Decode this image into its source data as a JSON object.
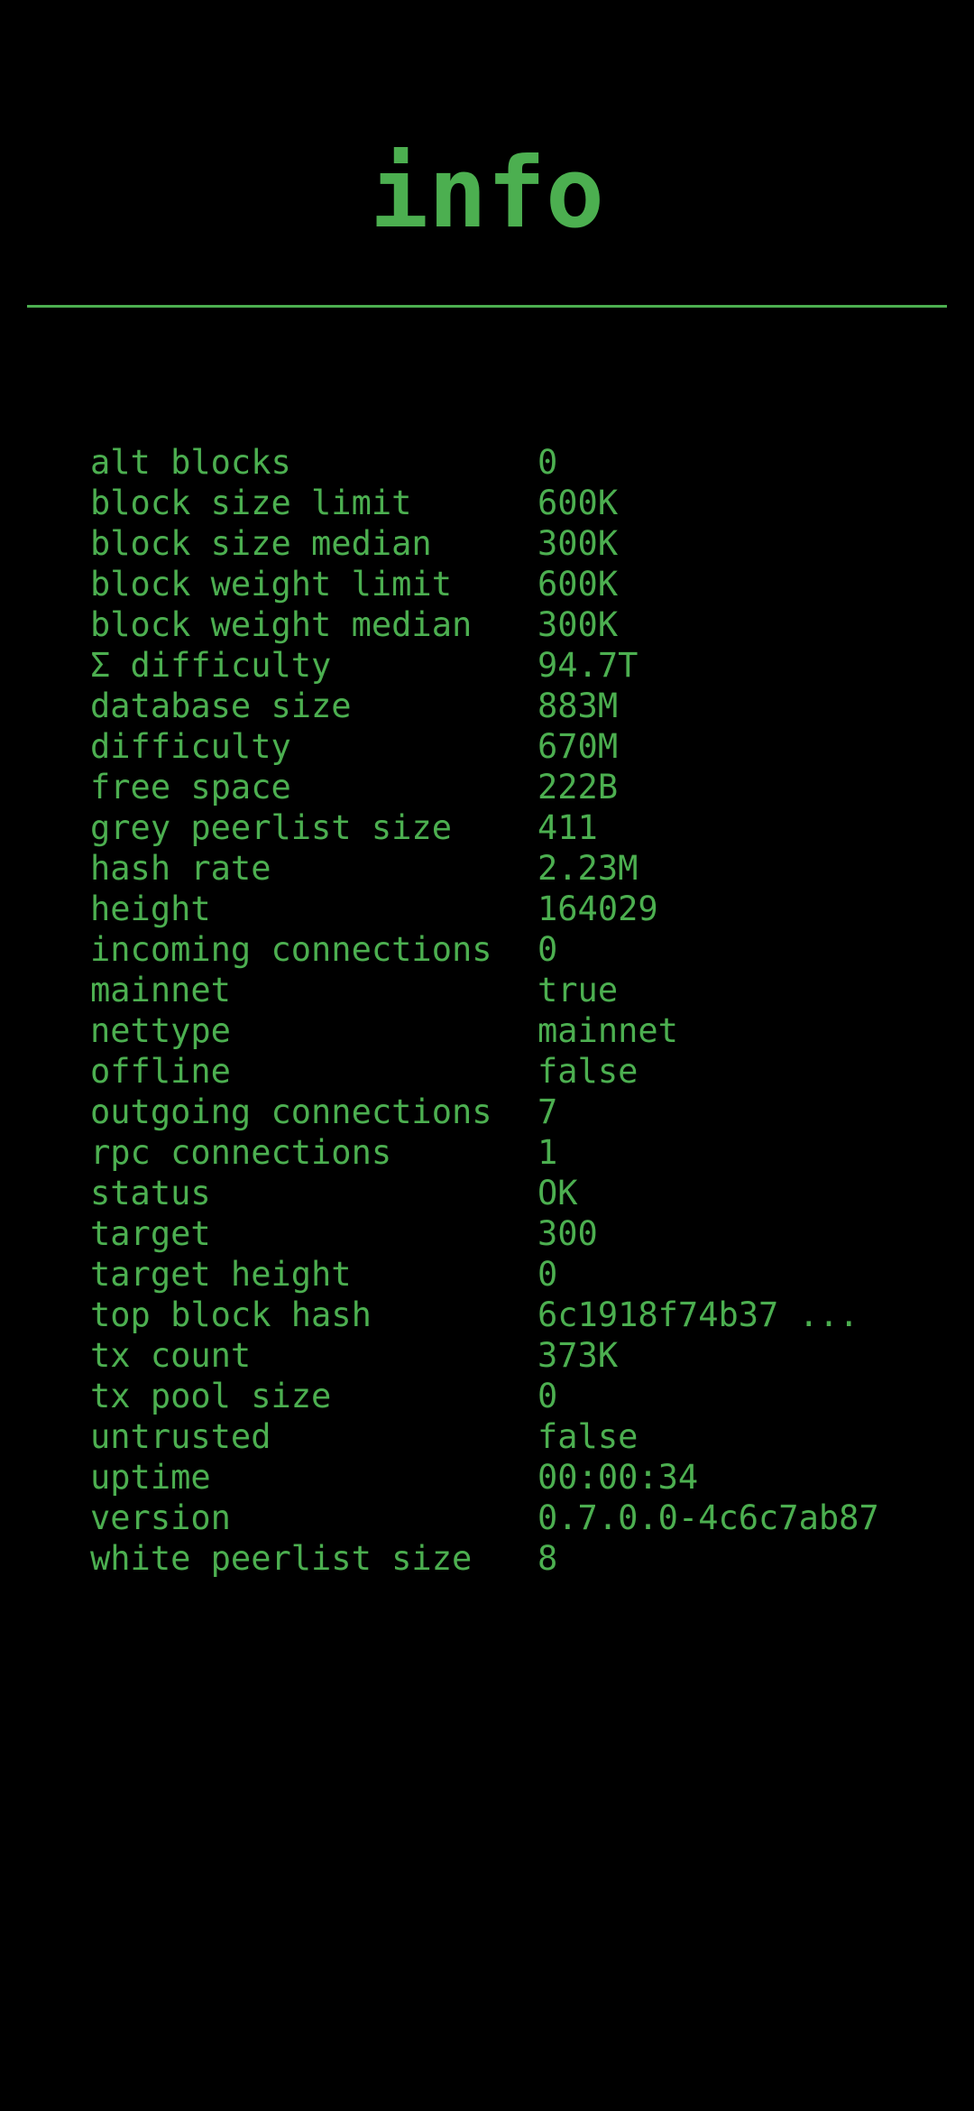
{
  "title": "info",
  "rows": [
    {
      "key": "alt blocks",
      "value": "0"
    },
    {
      "key": "block size limit",
      "value": "600K"
    },
    {
      "key": "block size median",
      "value": "300K"
    },
    {
      "key": "block weight limit",
      "value": "600K"
    },
    {
      "key": "block weight median",
      "value": "300K"
    },
    {
      "key": "Σ difficulty",
      "value": "94.7T"
    },
    {
      "key": "database size",
      "value": "883M"
    },
    {
      "key": "difficulty",
      "value": "670M"
    },
    {
      "key": "free space",
      "value": "222B"
    },
    {
      "key": "grey peerlist size",
      "value": "411"
    },
    {
      "key": "hash rate",
      "value": "2.23M"
    },
    {
      "key": "height",
      "value": "164029"
    },
    {
      "key": "incoming connections",
      "value": "0"
    },
    {
      "key": "mainnet",
      "value": "true"
    },
    {
      "key": "nettype",
      "value": "mainnet"
    },
    {
      "key": "offline",
      "value": "false"
    },
    {
      "key": "outgoing connections",
      "value": "7"
    },
    {
      "key": "rpc connections",
      "value": "1"
    },
    {
      "key": "status",
      "value": "OK"
    },
    {
      "key": "target",
      "value": "300"
    },
    {
      "key": "target height",
      "value": "0"
    },
    {
      "key": "top block hash",
      "value": "6c1918f74b37 ..."
    },
    {
      "key": "tx count",
      "value": "373K"
    },
    {
      "key": "tx pool size",
      "value": "0"
    },
    {
      "key": "untrusted",
      "value": "false"
    },
    {
      "key": "uptime",
      "value": "00:00:34"
    },
    {
      "key": "version",
      "value": "0.7.0.0-4c6c7ab87"
    },
    {
      "key": "white peerlist size",
      "value": "8"
    }
  ],
  "colors": {
    "background": "#000000",
    "accent": "#4caf50"
  }
}
